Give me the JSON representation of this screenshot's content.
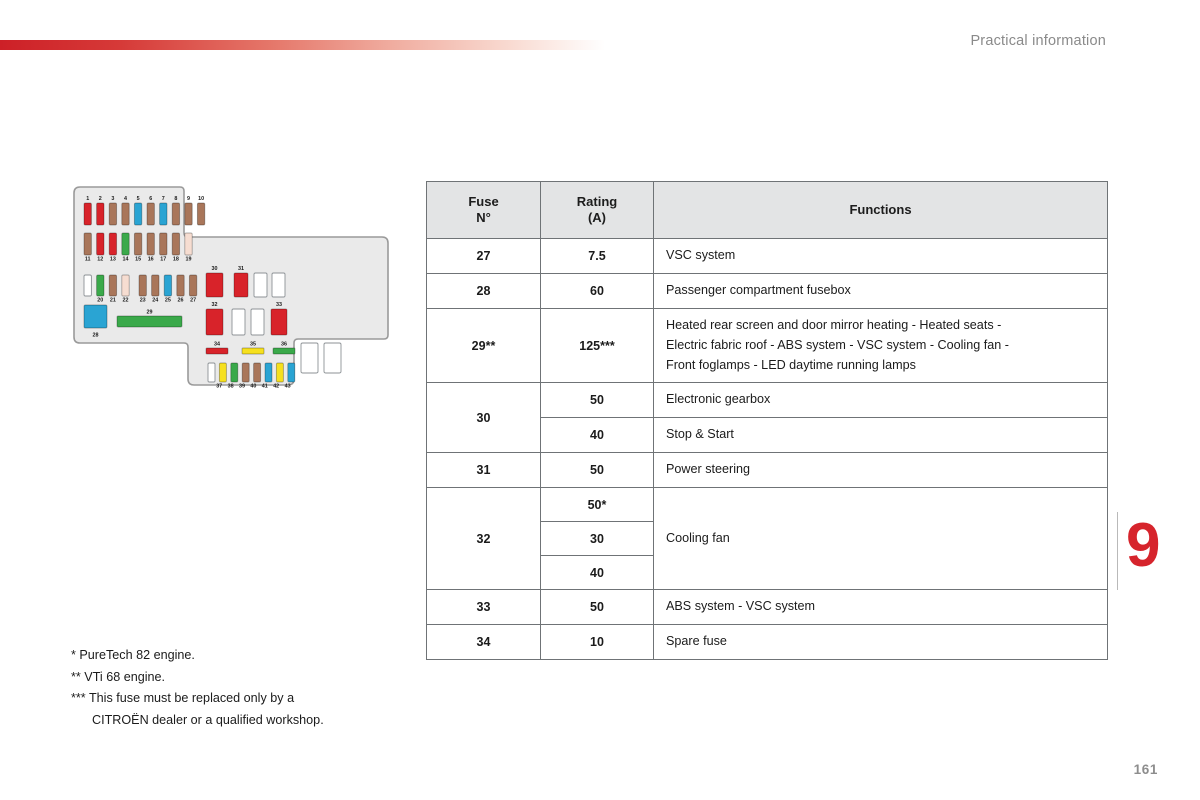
{
  "header": {
    "title": "Practical information",
    "rule_color_start": "#cd2027",
    "rule_color_end": "#ffffff"
  },
  "chapter": {
    "number": "9",
    "color": "#d6242c"
  },
  "page": {
    "number": "161"
  },
  "table": {
    "headers": {
      "fuse_line1": "Fuse",
      "fuse_line2": "N°",
      "rating_line1": "Rating",
      "rating_line2": "(A)",
      "functions": "Functions"
    },
    "rows": [
      {
        "fuse": "27",
        "ratings": [
          "7.5"
        ],
        "functions": [
          "VSC system"
        ]
      },
      {
        "fuse": "28",
        "ratings": [
          "60"
        ],
        "functions": [
          "Passenger compartment fusebox"
        ]
      },
      {
        "fuse": "29**",
        "ratings": [
          "125***"
        ],
        "functions": [
          "Heated rear screen and door mirror heating - Heated seats -\nElectric fabric roof - ABS system - VSC system - Cooling fan -\nFront foglamps - LED daytime running lamps"
        ]
      },
      {
        "fuse": "30",
        "ratings": [
          "50",
          "40"
        ],
        "functions": [
          "Electronic gearbox",
          "Stop & Start"
        ]
      },
      {
        "fuse": "31",
        "ratings": [
          "50"
        ],
        "functions": [
          "Power steering"
        ]
      },
      {
        "fuse": "32",
        "ratings": [
          "50*",
          "30",
          "40"
        ],
        "functions": [
          "Cooling fan"
        ]
      },
      {
        "fuse": "33",
        "ratings": [
          "50"
        ],
        "functions": [
          "ABS system - VSC system"
        ]
      },
      {
        "fuse": "34",
        "ratings": [
          "10"
        ],
        "functions": [
          "Spare fuse"
        ]
      }
    ]
  },
  "footnotes": [
    "* PureTech 82 engine.",
    "** VTi 68 engine.",
    "*** This fuse must be replaced only by a",
    "CITROËN dealer or a qualified workshop."
  ],
  "diagram": {
    "name": "engine-compartment-fusebox-diagram",
    "body_fill": "#eaeaea",
    "body_stroke": "#9a9a9a",
    "colors": {
      "red": "#d8232a",
      "brown": "#a9765a",
      "blue": "#2aa4d3",
      "green": "#3aa94a",
      "yellow": "#f6e01e",
      "pink": "#f6ddd1",
      "white": "#ffffff",
      "slot_stroke": "#8d9296"
    },
    "row1": {
      "labels": [
        "1",
        "2",
        "3",
        "4",
        "5",
        "6",
        "7",
        "8",
        "9",
        "10"
      ],
      "fuse_colors": [
        "red",
        "red",
        "brown",
        "brown",
        "blue",
        "brown",
        "blue",
        "brown",
        "brown",
        "brown"
      ]
    },
    "row2": {
      "labels": [
        "11",
        "12",
        "13",
        "14",
        "15",
        "16",
        "17",
        "18",
        "19"
      ],
      "fuse_colors": [
        "brown",
        "red",
        "red",
        "green",
        "brown",
        "brown",
        "brown",
        "brown",
        "pink"
      ]
    },
    "row3a": {
      "labels": [
        "",
        "20",
        "21",
        "22"
      ],
      "fuse_colors": [
        "white",
        "green",
        "brown",
        "pink"
      ]
    },
    "row3b": {
      "labels": [
        "23",
        "24",
        "25",
        "26",
        "27"
      ],
      "fuse_colors": [
        "brown",
        "brown",
        "blue",
        "brown",
        "brown"
      ]
    },
    "big": {
      "f28": {
        "label": "28",
        "color": "blue"
      },
      "f29": {
        "label": "29",
        "color": "green"
      },
      "f30": {
        "label": "30",
        "color": "red"
      },
      "f31": {
        "label": "31",
        "color": "red"
      },
      "f32": {
        "label": "32",
        "color": "red"
      },
      "f33": {
        "label": "33",
        "color": "red"
      },
      "f34": {
        "label": "34",
        "color": "red"
      },
      "f35": {
        "label": "35",
        "color": "yellow"
      },
      "f36": {
        "label": "36",
        "color": "green"
      }
    },
    "row4": {
      "labels": [
        "37",
        "38",
        "39",
        "40",
        "41",
        "42",
        "43"
      ],
      "fuse_colors": [
        "white",
        "yellow",
        "green",
        "brown",
        "brown",
        "blue",
        "yellow",
        "blue"
      ]
    }
  }
}
